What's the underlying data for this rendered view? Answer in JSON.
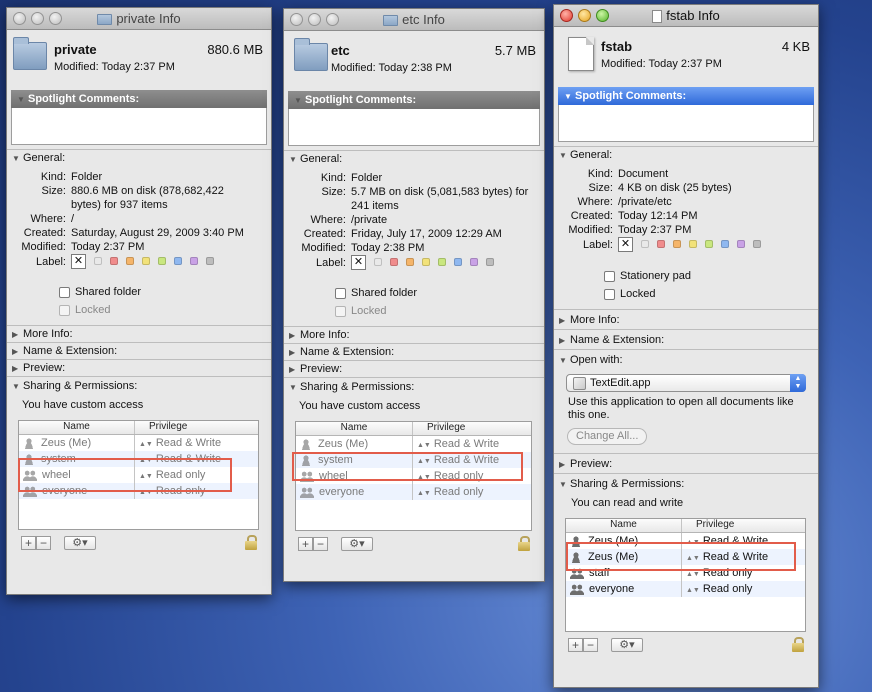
{
  "windows": [
    {
      "title": "private Info",
      "icon": "folder-icon",
      "name": "private",
      "size": "880.6 MB",
      "modified_line": "Modified: Today 2:37 PM",
      "spotlight": "Spotlight Comments:",
      "general": "General:",
      "kind_key": "Kind:",
      "kind": "Folder",
      "size_key": "Size:",
      "size_detail": "880.6 MB on disk (878,682,422 bytes) for 937 items",
      "where_key": "Where:",
      "where": "/",
      "created_key": "Created:",
      "created": "Saturday, August 29, 2009 3:40 PM",
      "modified_key": "Modified:",
      "modified": "Today 2:37 PM",
      "label_key": "Label:",
      "checkbox1": "Shared folder",
      "checkbox2": "Locked",
      "sections": [
        "More Info:",
        "Name & Extension:",
        "Preview:"
      ],
      "sharing": "Sharing & Permissions:",
      "access": "You have custom access",
      "col_name": "Name",
      "col_privilege": "Privilege",
      "perm_rows": [
        {
          "name": "Zeus (Me)",
          "privilege": "Read & Write"
        },
        {
          "name": "system",
          "privilege": "Read & Write"
        },
        {
          "name": "wheel",
          "privilege": "Read only"
        },
        {
          "name": "everyone",
          "privilege": "Read only"
        }
      ]
    },
    {
      "title": "etc Info",
      "icon": "folder-icon",
      "name": "etc",
      "size": "5.7 MB",
      "modified_line": "Modified: Today 2:38 PM",
      "spotlight": "Spotlight Comments:",
      "general": "General:",
      "kind_key": "Kind:",
      "kind": "Folder",
      "size_key": "Size:",
      "size_detail": "5.7 MB on disk (5,081,583 bytes) for 241 items",
      "where_key": "Where:",
      "where": "/private",
      "created_key": "Created:",
      "created": "Friday, July 17, 2009 12:29 AM",
      "modified_key": "Modified:",
      "modified": "Today 2:38 PM",
      "label_key": "Label:",
      "checkbox1": "Shared folder",
      "checkbox2": "Locked",
      "sections": [
        "More Info:",
        "Name & Extension:",
        "Preview:"
      ],
      "sharing": "Sharing & Permissions:",
      "access": "You have custom access",
      "col_name": "Name",
      "col_privilege": "Privilege",
      "perm_rows": [
        {
          "name": "Zeus (Me)",
          "privilege": "Read & Write"
        },
        {
          "name": "system",
          "privilege": "Read & Write"
        },
        {
          "name": "wheel",
          "privilege": "Read only"
        },
        {
          "name": "everyone",
          "privilege": "Read only"
        }
      ]
    },
    {
      "title": "fstab Info",
      "icon": "document-icon",
      "name": "fstab",
      "size": "4 KB",
      "modified_line": "Modified: Today 2:37 PM",
      "spotlight": "Spotlight Comments:",
      "general": "General:",
      "kind_key": "Kind:",
      "kind": "Document",
      "size_key": "Size:",
      "size_detail": "4 KB on disk (25 bytes)",
      "where_key": "Where:",
      "where": "/private/etc",
      "created_key": "Created:",
      "created": "Today 12:14 PM",
      "modified_key": "Modified:",
      "modified": "Today 2:37 PM",
      "label_key": "Label:",
      "checkbox1": "Stationery pad",
      "checkbox2": "Locked",
      "sections": [
        "More Info:",
        "Name & Extension:"
      ],
      "open_with": "Open with:",
      "app": "TextEdit.app",
      "open_help": "Use this application to open all documents like this one.",
      "change_all": "Change All...",
      "preview": "Preview:",
      "sharing": "Sharing & Permissions:",
      "access": "You can read and write",
      "col_name": "Name",
      "col_privilege": "Privilege",
      "perm_rows": [
        {
          "name": "Zeus (Me)",
          "privilege": "Read & Write"
        },
        {
          "name": "Zeus (Me)",
          "privilege": "Read & Write"
        },
        {
          "name": "staff",
          "privilege": "Read only"
        },
        {
          "name": "everyone",
          "privilege": "Read only"
        }
      ]
    }
  ],
  "label_colors": [
    "#e9e9e9",
    "#f08c8c",
    "#f5b56a",
    "#f2e27a",
    "#c9e77f",
    "#8fb8f0",
    "#c9a2e6",
    "#bdbdbd"
  ],
  "highlight_color": "#e25c4a"
}
